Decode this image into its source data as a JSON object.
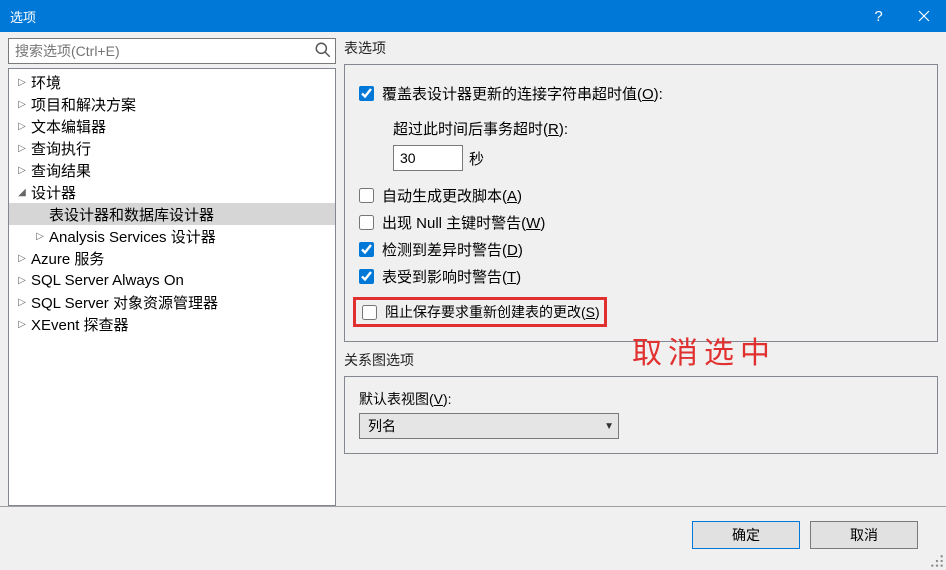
{
  "title": "选项",
  "search_placeholder": "搜索选项(Ctrl+E)",
  "tree": [
    {
      "label": "环境",
      "depth": 0,
      "expandable": true,
      "expanded": false
    },
    {
      "label": "项目和解决方案",
      "depth": 0,
      "expandable": true,
      "expanded": false
    },
    {
      "label": "文本编辑器",
      "depth": 0,
      "expandable": true,
      "expanded": false
    },
    {
      "label": "查询执行",
      "depth": 0,
      "expandable": true,
      "expanded": false
    },
    {
      "label": "查询结果",
      "depth": 0,
      "expandable": true,
      "expanded": false
    },
    {
      "label": "设计器",
      "depth": 0,
      "expandable": true,
      "expanded": true
    },
    {
      "label": "表设计器和数据库设计器",
      "depth": 1,
      "expandable": false,
      "selected": true
    },
    {
      "label": "Analysis Services 设计器",
      "depth": 1,
      "expandable": true,
      "expanded": false
    },
    {
      "label": "Azure 服务",
      "depth": 0,
      "expandable": true,
      "expanded": false
    },
    {
      "label": "SQL Server Always On",
      "depth": 0,
      "expandable": true,
      "expanded": false
    },
    {
      "label": "SQL Server 对象资源管理器",
      "depth": 0,
      "expandable": true,
      "expanded": false
    },
    {
      "label": "XEvent 探查器",
      "depth": 0,
      "expandable": true,
      "expanded": false
    }
  ],
  "table_options": {
    "group_label": "表选项",
    "override_conn": {
      "label_pre": "覆盖表设计器更新的连接字符串超时值(",
      "key": "O",
      "label_post": "):",
      "checked": true
    },
    "timeout_label_pre": "超过此时间后事务超时(",
    "timeout_key": "R",
    "timeout_label_post": "):",
    "timeout_value": "30",
    "timeout_unit": "秒",
    "auto_script": {
      "label_pre": "自动生成更改脚本(",
      "key": "A",
      "label_post": ")",
      "checked": false
    },
    "null_pk": {
      "label_pre": "出现 Null 主键时警告(",
      "key": "W",
      "label_post": ")",
      "checked": false
    },
    "diff_warn": {
      "label_pre": "检测到差异时警告(",
      "key": "D",
      "label_post": ")",
      "checked": true
    },
    "affected_warn": {
      "label_pre": "表受到影响时警告(",
      "key": "T",
      "label_post": ")",
      "checked": true
    },
    "prevent_save": {
      "label_pre": "阻止保存要求重新创建表的更改(",
      "key": "S",
      "label_post": ")",
      "checked": false
    }
  },
  "diagram_options": {
    "group_label": "关系图选项",
    "default_view_label_pre": "默认表视图(",
    "default_view_key": "V",
    "default_view_label_post": "):",
    "default_view_value": "列名"
  },
  "annotation": "取消选中",
  "buttons": {
    "ok": "确定",
    "cancel": "取消"
  }
}
